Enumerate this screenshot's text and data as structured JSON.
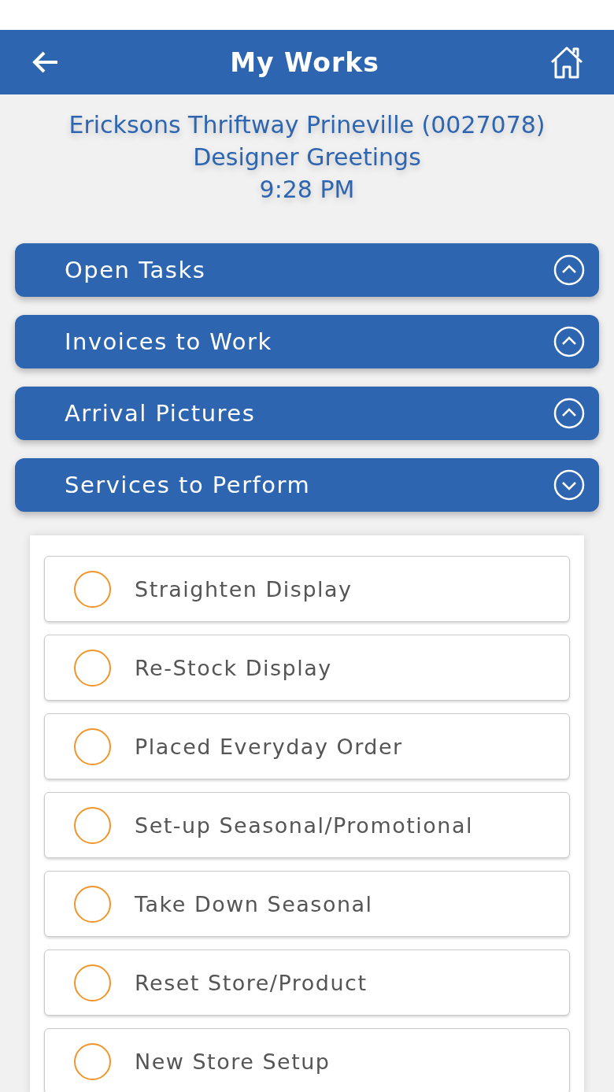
{
  "header": {
    "title": "My Works"
  },
  "store": {
    "name": "Ericksons Thriftway Prineville (0027078)",
    "vendor": "Designer Greetings",
    "time": "9:28 PM"
  },
  "sections": [
    {
      "label": "Open Tasks",
      "expanded": false
    },
    {
      "label": "Invoices to Work",
      "expanded": false
    },
    {
      "label": "Arrival Pictures",
      "expanded": false
    },
    {
      "label": "Services to Perform",
      "expanded": true
    }
  ],
  "services": [
    {
      "label": "Straighten Display",
      "checked": false
    },
    {
      "label": "Re-Stock Display",
      "checked": false
    },
    {
      "label": "Placed Everyday Order",
      "checked": false
    },
    {
      "label": "Set-up Seasonal/Promotional",
      "checked": false
    },
    {
      "label": "Take Down Seasonal",
      "checked": false
    },
    {
      "label": "Reset Store/Product",
      "checked": false
    },
    {
      "label": "New Store Setup",
      "checked": false
    }
  ]
}
